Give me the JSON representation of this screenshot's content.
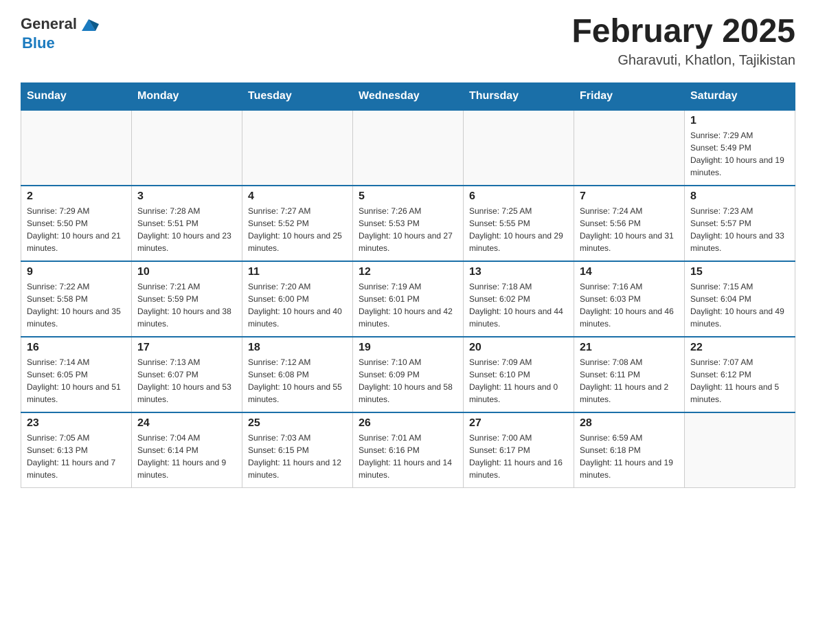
{
  "header": {
    "logo_text_general": "General",
    "logo_text_blue": "Blue",
    "month_title": "February 2025",
    "location": "Gharavuti, Khatlon, Tajikistan"
  },
  "days_of_week": [
    "Sunday",
    "Monday",
    "Tuesday",
    "Wednesday",
    "Thursday",
    "Friday",
    "Saturday"
  ],
  "weeks": [
    [
      {
        "day": "",
        "info": ""
      },
      {
        "day": "",
        "info": ""
      },
      {
        "day": "",
        "info": ""
      },
      {
        "day": "",
        "info": ""
      },
      {
        "day": "",
        "info": ""
      },
      {
        "day": "",
        "info": ""
      },
      {
        "day": "1",
        "info": "Sunrise: 7:29 AM\nSunset: 5:49 PM\nDaylight: 10 hours and 19 minutes."
      }
    ],
    [
      {
        "day": "2",
        "info": "Sunrise: 7:29 AM\nSunset: 5:50 PM\nDaylight: 10 hours and 21 minutes."
      },
      {
        "day": "3",
        "info": "Sunrise: 7:28 AM\nSunset: 5:51 PM\nDaylight: 10 hours and 23 minutes."
      },
      {
        "day": "4",
        "info": "Sunrise: 7:27 AM\nSunset: 5:52 PM\nDaylight: 10 hours and 25 minutes."
      },
      {
        "day": "5",
        "info": "Sunrise: 7:26 AM\nSunset: 5:53 PM\nDaylight: 10 hours and 27 minutes."
      },
      {
        "day": "6",
        "info": "Sunrise: 7:25 AM\nSunset: 5:55 PM\nDaylight: 10 hours and 29 minutes."
      },
      {
        "day": "7",
        "info": "Sunrise: 7:24 AM\nSunset: 5:56 PM\nDaylight: 10 hours and 31 minutes."
      },
      {
        "day": "8",
        "info": "Sunrise: 7:23 AM\nSunset: 5:57 PM\nDaylight: 10 hours and 33 minutes."
      }
    ],
    [
      {
        "day": "9",
        "info": "Sunrise: 7:22 AM\nSunset: 5:58 PM\nDaylight: 10 hours and 35 minutes."
      },
      {
        "day": "10",
        "info": "Sunrise: 7:21 AM\nSunset: 5:59 PM\nDaylight: 10 hours and 38 minutes."
      },
      {
        "day": "11",
        "info": "Sunrise: 7:20 AM\nSunset: 6:00 PM\nDaylight: 10 hours and 40 minutes."
      },
      {
        "day": "12",
        "info": "Sunrise: 7:19 AM\nSunset: 6:01 PM\nDaylight: 10 hours and 42 minutes."
      },
      {
        "day": "13",
        "info": "Sunrise: 7:18 AM\nSunset: 6:02 PM\nDaylight: 10 hours and 44 minutes."
      },
      {
        "day": "14",
        "info": "Sunrise: 7:16 AM\nSunset: 6:03 PM\nDaylight: 10 hours and 46 minutes."
      },
      {
        "day": "15",
        "info": "Sunrise: 7:15 AM\nSunset: 6:04 PM\nDaylight: 10 hours and 49 minutes."
      }
    ],
    [
      {
        "day": "16",
        "info": "Sunrise: 7:14 AM\nSunset: 6:05 PM\nDaylight: 10 hours and 51 minutes."
      },
      {
        "day": "17",
        "info": "Sunrise: 7:13 AM\nSunset: 6:07 PM\nDaylight: 10 hours and 53 minutes."
      },
      {
        "day": "18",
        "info": "Sunrise: 7:12 AM\nSunset: 6:08 PM\nDaylight: 10 hours and 55 minutes."
      },
      {
        "day": "19",
        "info": "Sunrise: 7:10 AM\nSunset: 6:09 PM\nDaylight: 10 hours and 58 minutes."
      },
      {
        "day": "20",
        "info": "Sunrise: 7:09 AM\nSunset: 6:10 PM\nDaylight: 11 hours and 0 minutes."
      },
      {
        "day": "21",
        "info": "Sunrise: 7:08 AM\nSunset: 6:11 PM\nDaylight: 11 hours and 2 minutes."
      },
      {
        "day": "22",
        "info": "Sunrise: 7:07 AM\nSunset: 6:12 PM\nDaylight: 11 hours and 5 minutes."
      }
    ],
    [
      {
        "day": "23",
        "info": "Sunrise: 7:05 AM\nSunset: 6:13 PM\nDaylight: 11 hours and 7 minutes."
      },
      {
        "day": "24",
        "info": "Sunrise: 7:04 AM\nSunset: 6:14 PM\nDaylight: 11 hours and 9 minutes."
      },
      {
        "day": "25",
        "info": "Sunrise: 7:03 AM\nSunset: 6:15 PM\nDaylight: 11 hours and 12 minutes."
      },
      {
        "day": "26",
        "info": "Sunrise: 7:01 AM\nSunset: 6:16 PM\nDaylight: 11 hours and 14 minutes."
      },
      {
        "day": "27",
        "info": "Sunrise: 7:00 AM\nSunset: 6:17 PM\nDaylight: 11 hours and 16 minutes."
      },
      {
        "day": "28",
        "info": "Sunrise: 6:59 AM\nSunset: 6:18 PM\nDaylight: 11 hours and 19 minutes."
      },
      {
        "day": "",
        "info": ""
      }
    ]
  ]
}
